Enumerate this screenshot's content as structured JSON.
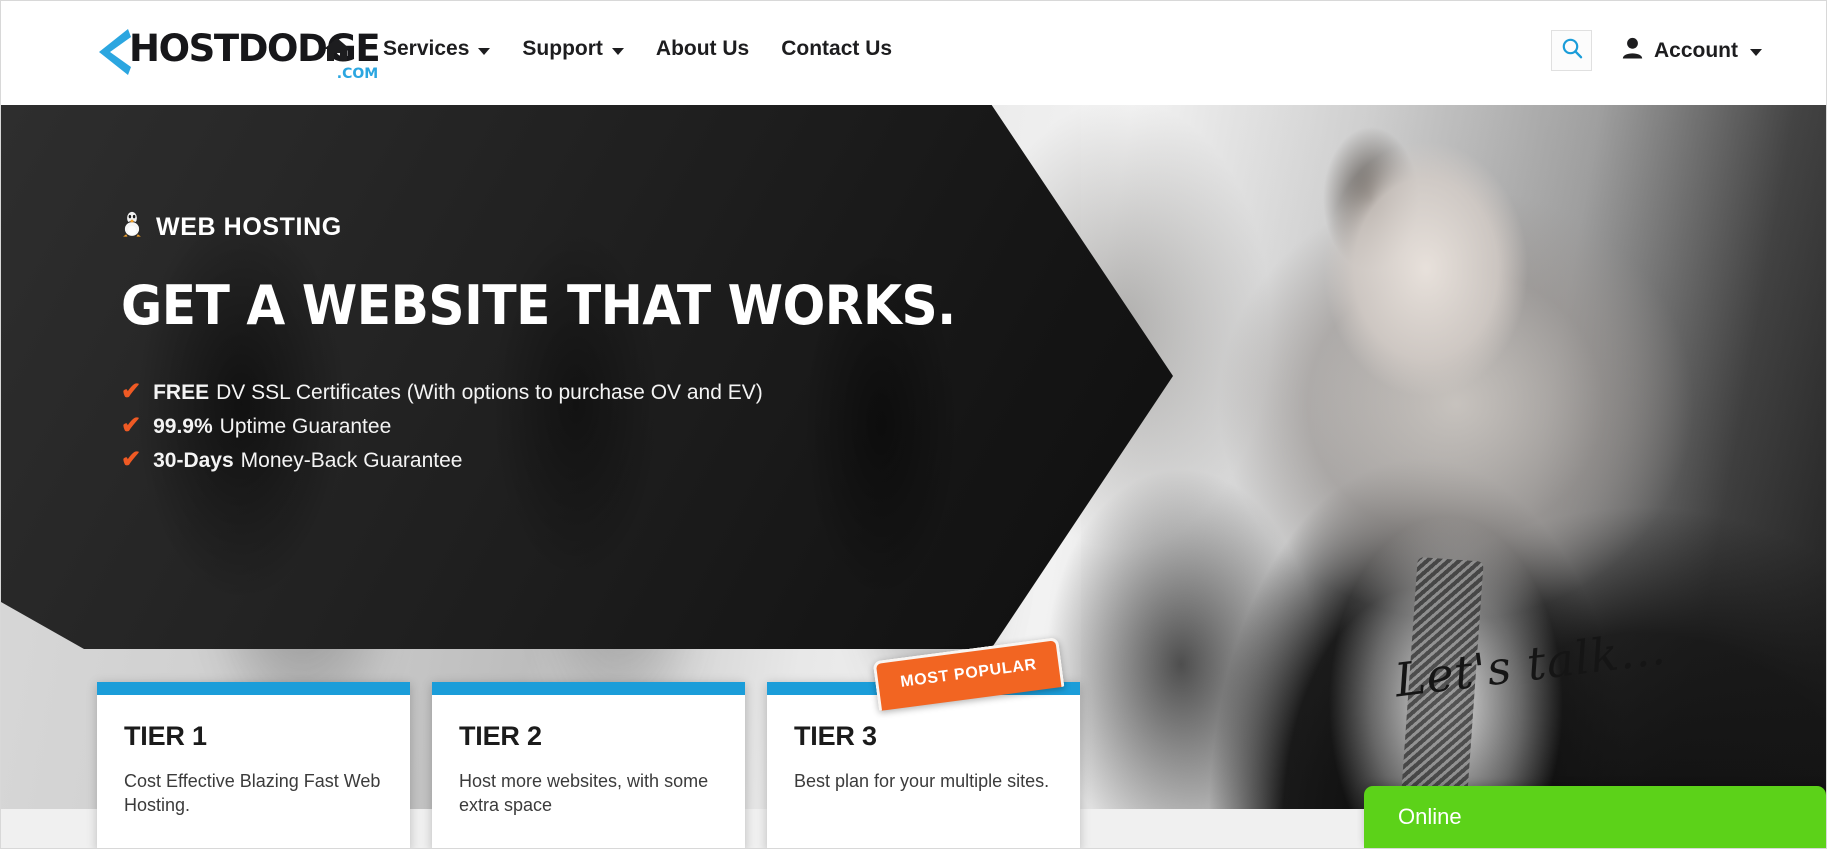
{
  "brand": {
    "logo_main": "HOSTDODGE",
    "logo_suffix": ".COM",
    "chevron_color": "#2ba6e0",
    "accent_blue": "#1b9dd9",
    "accent_orange": "#f26522",
    "chat_green": "#5cd219"
  },
  "header": {
    "home_icon": "home-icon",
    "nav": [
      {
        "label": "Services",
        "has_dropdown": true
      },
      {
        "label": "Support",
        "has_dropdown": true
      },
      {
        "label": "About Us",
        "has_dropdown": false
      },
      {
        "label": "Contact Us",
        "has_dropdown": false
      }
    ],
    "search_icon": "search-icon",
    "account": {
      "label": "Account",
      "icon": "user-icon",
      "has_dropdown": true
    }
  },
  "hero": {
    "eyebrow": "WEB HOSTING",
    "eyebrow_icon": "linux-tux-icon",
    "title": "GET A WEBSITE THAT WORKS.",
    "features": [
      {
        "strong": "FREE",
        "rest": "DV SSL Certificates (With options to purchase OV and EV)"
      },
      {
        "strong": "99.9%",
        "rest": "Uptime Guarantee"
      },
      {
        "strong": "30-Days",
        "rest": "Money-Back Guarantee"
      }
    ],
    "check_glyph": "✔",
    "handwriting": "Let's talk..."
  },
  "pricing": {
    "ribbon_label": "MOST POPULAR",
    "cards": [
      {
        "title": "TIER 1",
        "desc": "Cost Effective Blazing Fast Web Hosting."
      },
      {
        "title": "TIER 2",
        "desc": "Host more websites, with some extra space"
      },
      {
        "title": "TIER 3",
        "desc": "Best plan for your multiple sites."
      }
    ]
  },
  "chat": {
    "status": "Online"
  }
}
